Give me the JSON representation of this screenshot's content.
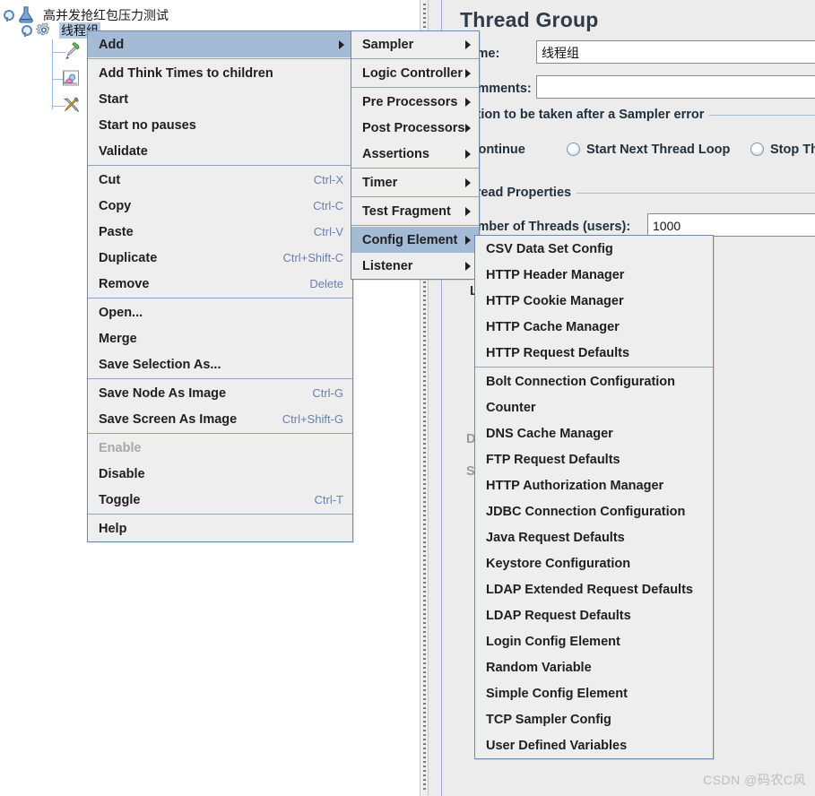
{
  "tree": {
    "nodes": [
      {
        "label": "高并发抢红包压力测试",
        "icon": "test-plan-flask-icon",
        "selected": false
      },
      {
        "label": "线程组",
        "icon": "thread-group-gear-icon",
        "selected": true
      },
      {
        "label": "",
        "icon": "http-request-pipette-icon",
        "selected": false
      },
      {
        "label": "",
        "icon": "graph-results-chart-icon",
        "selected": false
      },
      {
        "label": "",
        "icon": "tools-wrench-screwdriver-icon",
        "selected": false
      }
    ]
  },
  "panel": {
    "title": "Thread Group",
    "name_label": "Name:",
    "name_value": "线程组",
    "comments_label": "Comments:",
    "comments_value": "",
    "error_action_group": "Action to be taken after a Sampler error",
    "error_actions": [
      {
        "label": "Continue",
        "selected": true
      },
      {
        "label": "Start Next Thread Loop",
        "selected": false
      },
      {
        "label": "Stop Thread",
        "selected": false
      }
    ],
    "thread_properties_group": "Thread Properties",
    "num_threads_label": "Number of Threads (users):",
    "num_threads_value": "1000",
    "loop_label": "Lo",
    "duration_label": "Du",
    "startup_label": "Sta",
    "checkboxes": [
      {
        "state": "checked"
      },
      {
        "state": "unchecked"
      },
      {
        "state": "unchecked"
      }
    ]
  },
  "context_menu": {
    "items": [
      {
        "label": "Add",
        "accel": "",
        "submenu": true,
        "highlighted": true,
        "disabled": false
      },
      {
        "separator": true
      },
      {
        "label": "Add Think Times to children",
        "accel": "",
        "submenu": false,
        "highlighted": false,
        "disabled": false
      },
      {
        "label": "Start",
        "accel": "",
        "submenu": false,
        "highlighted": false,
        "disabled": false
      },
      {
        "label": "Start no pauses",
        "accel": "",
        "submenu": false,
        "highlighted": false,
        "disabled": false
      },
      {
        "label": "Validate",
        "accel": "",
        "submenu": false,
        "highlighted": false,
        "disabled": false
      },
      {
        "separator": true
      },
      {
        "label": "Cut",
        "accel": "Ctrl-X",
        "submenu": false,
        "highlighted": false,
        "disabled": false
      },
      {
        "label": "Copy",
        "accel": "Ctrl-C",
        "submenu": false,
        "highlighted": false,
        "disabled": false
      },
      {
        "label": "Paste",
        "accel": "Ctrl-V",
        "submenu": false,
        "highlighted": false,
        "disabled": false
      },
      {
        "label": "Duplicate",
        "accel": "Ctrl+Shift-C",
        "submenu": false,
        "highlighted": false,
        "disabled": false
      },
      {
        "label": "Remove",
        "accel": "Delete",
        "submenu": false,
        "highlighted": false,
        "disabled": false
      },
      {
        "separator": true
      },
      {
        "label": "Open...",
        "accel": "",
        "submenu": false,
        "highlighted": false,
        "disabled": false
      },
      {
        "label": "Merge",
        "accel": "",
        "submenu": false,
        "highlighted": false,
        "disabled": false
      },
      {
        "label": "Save Selection As...",
        "accel": "",
        "submenu": false,
        "highlighted": false,
        "disabled": false
      },
      {
        "separator": true
      },
      {
        "label": "Save Node As Image",
        "accel": "Ctrl-G",
        "submenu": false,
        "highlighted": false,
        "disabled": false
      },
      {
        "label": "Save Screen As Image",
        "accel": "Ctrl+Shift-G",
        "submenu": false,
        "highlighted": false,
        "disabled": false
      },
      {
        "separator": true
      },
      {
        "label": "Enable",
        "accel": "",
        "submenu": false,
        "highlighted": false,
        "disabled": true
      },
      {
        "label": "Disable",
        "accel": "",
        "submenu": false,
        "highlighted": false,
        "disabled": false
      },
      {
        "label": "Toggle",
        "accel": "Ctrl-T",
        "submenu": false,
        "highlighted": false,
        "disabled": false
      },
      {
        "separator": true
      },
      {
        "label": "Help",
        "accel": "",
        "submenu": false,
        "highlighted": false,
        "disabled": false
      }
    ]
  },
  "add_menu": {
    "items": [
      {
        "label": "Sampler",
        "submenu": true,
        "highlighted": false
      },
      {
        "separator": true
      },
      {
        "label": "Logic Controller",
        "submenu": true,
        "highlighted": false
      },
      {
        "separator": true
      },
      {
        "label": "Pre Processors",
        "submenu": true,
        "highlighted": false
      },
      {
        "label": "Post Processors",
        "submenu": true,
        "highlighted": false
      },
      {
        "label": "Assertions",
        "submenu": true,
        "highlighted": false
      },
      {
        "separator": true
      },
      {
        "label": "Timer",
        "submenu": true,
        "highlighted": false
      },
      {
        "separator": true
      },
      {
        "label": "Test Fragment",
        "submenu": true,
        "highlighted": false
      },
      {
        "separator": true
      },
      {
        "label": "Config Element",
        "submenu": true,
        "highlighted": true
      },
      {
        "label": "Listener",
        "submenu": true,
        "highlighted": false
      }
    ]
  },
  "config_element_menu": {
    "items": [
      {
        "label": "CSV Data Set Config"
      },
      {
        "label": "HTTP Header Manager"
      },
      {
        "label": "HTTP Cookie Manager"
      },
      {
        "label": "HTTP Cache Manager"
      },
      {
        "label": "HTTP Request Defaults"
      },
      {
        "separator": true
      },
      {
        "label": "Bolt Connection Configuration"
      },
      {
        "label": "Counter"
      },
      {
        "label": "DNS Cache Manager"
      },
      {
        "label": "FTP Request Defaults"
      },
      {
        "label": "HTTP Authorization Manager"
      },
      {
        "label": "JDBC Connection Configuration"
      },
      {
        "label": "Java Request Defaults"
      },
      {
        "label": "Keystore Configuration"
      },
      {
        "label": "LDAP Extended Request Defaults"
      },
      {
        "label": "LDAP Request Defaults"
      },
      {
        "label": "Login Config Element"
      },
      {
        "label": "Random Variable"
      },
      {
        "label": "Simple Config Element"
      },
      {
        "label": "TCP Sampler Config"
      },
      {
        "label": "User Defined Variables"
      }
    ]
  },
  "watermark": "CSDN @码农C风",
  "colors": {
    "menu_bg": "#eeeeee",
    "menu_border": "#6f8aa8",
    "highlight": "#a4bbd6",
    "accel": "#6a7fb0",
    "panel_bg": "#ececec",
    "tree_selection": "#b6cce5"
  }
}
